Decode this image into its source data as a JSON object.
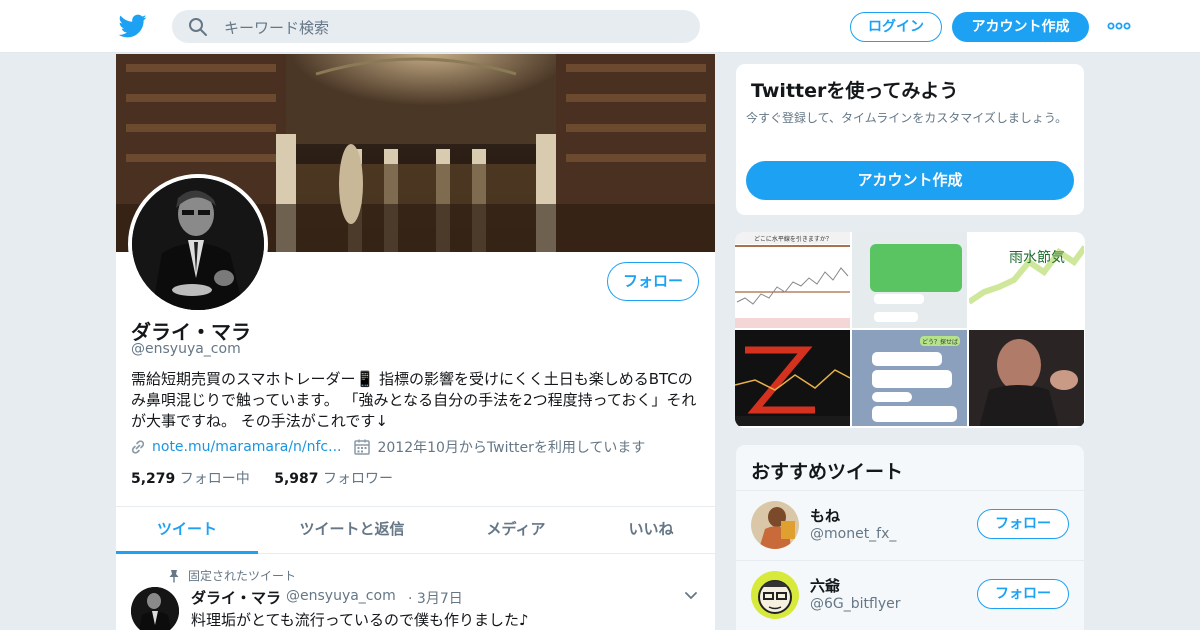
{
  "topbar": {
    "search_placeholder": "キーワード検索",
    "login_label": "ログイン",
    "signup_label": "アカウント作成"
  },
  "profile": {
    "follow_label": "フォロー",
    "name": "ダライ・マラ",
    "handle": "@ensyuya_com",
    "bio": "需給短期売買のスマホトレーダー📱 指標の影響を受けにくく土日も楽しめるBTCのみ鼻唄混じりで触っています。 「強みとなる自分の手法を2つ程度持っておく」それが大事ですね。 その手法がこれです↓",
    "link": "note.mu/maramara/n/nfc...",
    "joined": "2012年10月からTwitterを利用しています",
    "following_count": "5,279",
    "following_label": "フォロー中",
    "followers_count": "5,987",
    "followers_label": "フォロワー"
  },
  "tabs": [
    "ツイート",
    "ツイートと返信",
    "メディア",
    "いいね"
  ],
  "tweet": {
    "pinned_label": "固定されたツイート",
    "name": "ダライ・マラ",
    "handle": "@ensyuya_com",
    "date": "3月7日",
    "text": "料理垢がとても流行っているので僕も作りました♪"
  },
  "try_card": {
    "title": "Twitterを使ってみよう",
    "desc": "今すぐ登録して、タイムラインをカスタマイズしましょう。",
    "cta": "アカウント作成"
  },
  "media": {
    "thumb1_caption": "どこに水平線を引きますか？",
    "thumb5_text": "どう？探せば",
    "thumb3_text": "雨水節気"
  },
  "recommended": {
    "title": "おすすめツイート",
    "follow_label": "フォロー",
    "users": [
      {
        "name": "もね",
        "handle": "@monet_fx_"
      },
      {
        "name": "六爺",
        "handle": "@6G_bitflyer"
      }
    ]
  }
}
